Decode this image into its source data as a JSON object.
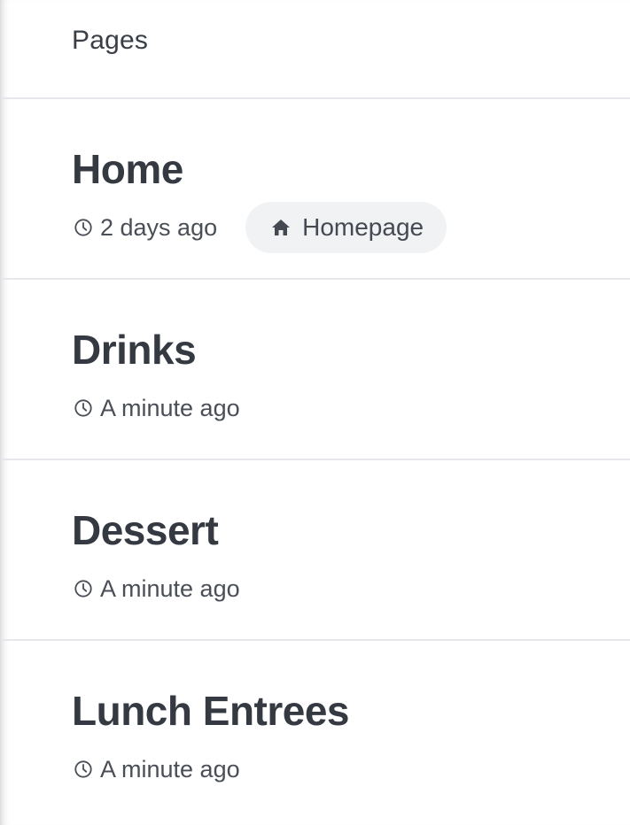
{
  "header": {
    "title": "Pages"
  },
  "pages": [
    {
      "title": "Home",
      "updated": "2 days ago",
      "badge": "Homepage",
      "badge_icon": "home-icon"
    },
    {
      "title": "Drinks",
      "updated": "A minute ago"
    },
    {
      "title": "Dessert",
      "updated": "A minute ago"
    },
    {
      "title": "Lunch Entrees",
      "updated": "A minute ago"
    }
  ],
  "icons": {
    "clock": "clock-icon",
    "home": "home-icon"
  },
  "colors": {
    "text": "#353a42",
    "meta_text": "#4a4f57",
    "badge_bg": "#f1f2f4",
    "divider": "#e6e7ea"
  }
}
